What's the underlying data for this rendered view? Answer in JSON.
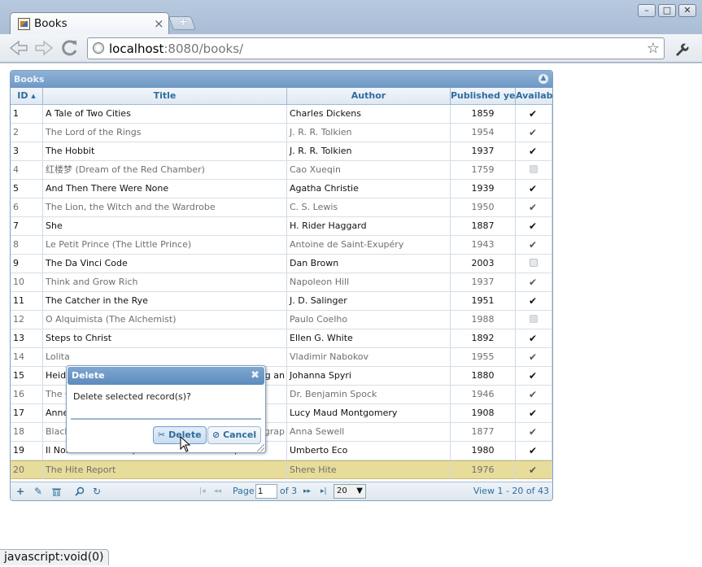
{
  "browser": {
    "tab_title": "Books",
    "tab_close": "×",
    "new_tab": "+",
    "url_host": "localhost",
    "url_rest": ":8080/books/",
    "status_text": "javascript:void(0)",
    "controls": {
      "minimize": "–",
      "maximize": "□",
      "close": "✕"
    }
  },
  "grid": {
    "caption": "Books",
    "collapse_icon": "▲",
    "columns": {
      "id": "ID",
      "title": "Title",
      "author": "Author",
      "year": "Published yea",
      "available": "Availabl"
    },
    "sort_indicator": "▲",
    "rows": [
      {
        "id": "1",
        "title": "A Tale of Two Cities",
        "author": "Charles Dickens",
        "year": "1859",
        "available": true
      },
      {
        "id": "2",
        "title": "The Lord of the Rings",
        "author": "J. R. R. Tolkien",
        "year": "1954",
        "available": true
      },
      {
        "id": "3",
        "title": "The Hobbit",
        "author": "J. R. R. Tolkien",
        "year": "1937",
        "available": true
      },
      {
        "id": "4",
        "title": "红楼梦 (Dream of the Red Chamber)",
        "author": "Cao Xueqin",
        "year": "1759",
        "available": false
      },
      {
        "id": "5",
        "title": "And Then There Were None",
        "author": "Agatha Christie",
        "year": "1939",
        "available": true
      },
      {
        "id": "6",
        "title": "The Lion, the Witch and the Wardrobe",
        "author": "C. S. Lewis",
        "year": "1950",
        "available": true
      },
      {
        "id": "7",
        "title": "She",
        "author": "H. Rider Haggard",
        "year": "1887",
        "available": true
      },
      {
        "id": "8",
        "title": "Le Petit Prince (The Little Prince)",
        "author": "Antoine de Saint-Exupéry",
        "year": "1943",
        "available": true
      },
      {
        "id": "9",
        "title": "The Da Vinci Code",
        "author": "Dan Brown",
        "year": "2003",
        "available": false
      },
      {
        "id": "10",
        "title": "Think and Grow Rich",
        "author": "Napoleon Hill",
        "year": "1937",
        "available": true
      },
      {
        "id": "11",
        "title": "The Catcher in the Rye",
        "author": "J. D. Salinger",
        "year": "1951",
        "available": true
      },
      {
        "id": "12",
        "title": "O Alquimista (The Alchemist)",
        "author": "Paulo Coelho",
        "year": "1988",
        "available": false
      },
      {
        "id": "13",
        "title": "Steps to Christ",
        "author": "Ellen G. White",
        "year": "1892",
        "available": true
      },
      {
        "id": "14",
        "title": "Lolita",
        "author": "Vladimir Nabokov",
        "year": "1955",
        "available": true
      },
      {
        "id": "15",
        "title": "Heidi",
        "title_tail": "ng an",
        "author": "Johanna Spyri",
        "year": "1880",
        "available": true
      },
      {
        "id": "16",
        "title": "The C",
        "author": "Dr. Benjamin Spock",
        "year": "1946",
        "available": true
      },
      {
        "id": "17",
        "title": "Anne",
        "author": "Lucy Maud Montgomery",
        "year": "1908",
        "available": true
      },
      {
        "id": "18",
        "title": "Black",
        "title_tail": "ograp",
        "author": "Anna Sewell",
        "year": "1877",
        "available": true
      },
      {
        "id": "19",
        "title": "Il Nome della Rosa (The Name of the Rose)",
        "author": "Umberto Eco",
        "year": "1980",
        "available": true
      },
      {
        "id": "20",
        "title": "The Hite Report",
        "author": "Shere Hite",
        "year": "1976",
        "available": true
      }
    ],
    "highlighted_row": "20"
  },
  "pager": {
    "add_icon": "+",
    "edit_icon": "✎",
    "delete_icon": "🗑",
    "search_icon": "⚲",
    "refresh_icon": "↻",
    "first_icon": "|◂",
    "prev_icon": "◂◂",
    "next_icon": "▸▸",
    "last_icon": "▸|",
    "page_label": "Page",
    "page_value": "1",
    "of_label": "of 3",
    "rows_per_page": "20",
    "record_info": "View 1 - 20 of 43"
  },
  "dialog": {
    "title": "Delete",
    "close_icon": "✖",
    "message": "Delete selected record(s)?",
    "delete_label": "Delete",
    "cancel_label": "Cancel",
    "delete_icon": "✂",
    "cancel_icon": "⊘"
  }
}
